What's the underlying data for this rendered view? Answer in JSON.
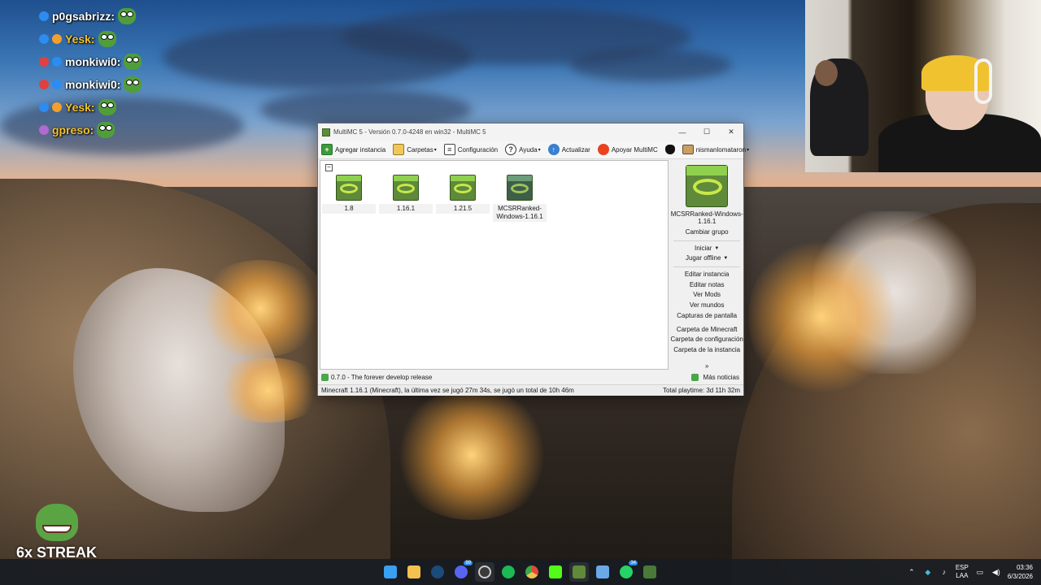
{
  "chat": [
    {
      "user": "p0gsabrizz:",
      "badges": [
        "#2d8cf0"
      ],
      "style": "white"
    },
    {
      "user": "Yesk:",
      "badges": [
        "#2d8cf0",
        "#f29f2c"
      ],
      "style": "yellow"
    },
    {
      "user": "monkiwi0:",
      "badges": [
        "#e04040",
        "#2d8cf0"
      ],
      "style": "white"
    },
    {
      "user": "monkiwi0:",
      "badges": [
        "#e04040",
        "#2d8cf0"
      ],
      "style": "white"
    },
    {
      "user": "Yesk:",
      "badges": [
        "#2d8cf0",
        "#f29f2c"
      ],
      "style": "yellow"
    },
    {
      "user": "gpreso:",
      "badges": [
        "#b06ad0"
      ],
      "style": "yellow"
    }
  ],
  "streak": {
    "label": "6x STREAK"
  },
  "window": {
    "title": "MultiMC 5 - Versión 0.7.0-4248 en win32 - MultiMC 5",
    "controls": {
      "minimize": "—",
      "maximize": "☐",
      "close": "✕"
    },
    "toolbar": {
      "add_instance": "Agregar instancia",
      "folders": "Carpetas",
      "settings": "Configuración",
      "help": "Ayuda",
      "update": "Actualizar",
      "support": "Apoyar MultiMC",
      "account": "nismanlomataron"
    },
    "group_toggle": "−",
    "instances": [
      {
        "name": "1.8",
        "variant": "normal"
      },
      {
        "name": "1.16.1",
        "variant": "normal"
      },
      {
        "name": "1.21.5",
        "variant": "normal"
      },
      {
        "name": "MCSRRanked-Windows-1.16.1",
        "variant": "dark"
      }
    ],
    "side_panel": {
      "instance_name": "MCSRRanked-Windows-1.16.1",
      "change_group": "Cambiar grupo",
      "launch": "Iniciar",
      "launch_offline": "Jugar offline",
      "edit_instance": "Editar instancia",
      "edit_notes": "Editar notas",
      "view_mods": "Ver Mods",
      "view_worlds": "Ver mundos",
      "screenshots": "Capturas de pantalla",
      "minecraft_folder": "Carpeta de Minecraft",
      "config_folder": "Carpeta de configuración",
      "instance_folder": "Carpeta de la instancia",
      "more": "»"
    },
    "news": {
      "headline": "0.7.0 - The forever develop release",
      "more": "Más noticias"
    },
    "status": {
      "left": "Minecraft 1.16.1 (Minecraft), la última vez se jugó 27m 34s, se jugó un total de 10h 46m",
      "right": "Total playtime: 3d 11h 32m"
    }
  },
  "taskbar": {
    "apps": [
      {
        "name": "windows-start-icon",
        "color": "#3aa0f0"
      },
      {
        "name": "file-explorer-icon",
        "color": "#f2c14e"
      },
      {
        "name": "steam-icon",
        "color": "#1b4b78"
      },
      {
        "name": "discord-icon",
        "color": "#5865f2",
        "count": "99"
      },
      {
        "name": "obs-icon",
        "color": "#3a3a3a"
      },
      {
        "name": "spotify-icon",
        "color": "#1db954"
      },
      {
        "name": "chrome-icon",
        "color": "#e8b33a"
      },
      {
        "name": "kick-icon",
        "color": "#53fc18"
      },
      {
        "name": "multimc-icon",
        "color": "#5f8a3a"
      },
      {
        "name": "notepad-icon",
        "color": "#6aa8e8"
      },
      {
        "name": "whatsapp-icon",
        "color": "#25d366",
        "count": "34"
      },
      {
        "name": "minecraft-icon",
        "color": "#4a7a3a"
      }
    ],
    "tray": {
      "lang_top": "ESP",
      "lang_bottom": "LAA",
      "time": "03:36",
      "date": "6/3/2026"
    }
  }
}
